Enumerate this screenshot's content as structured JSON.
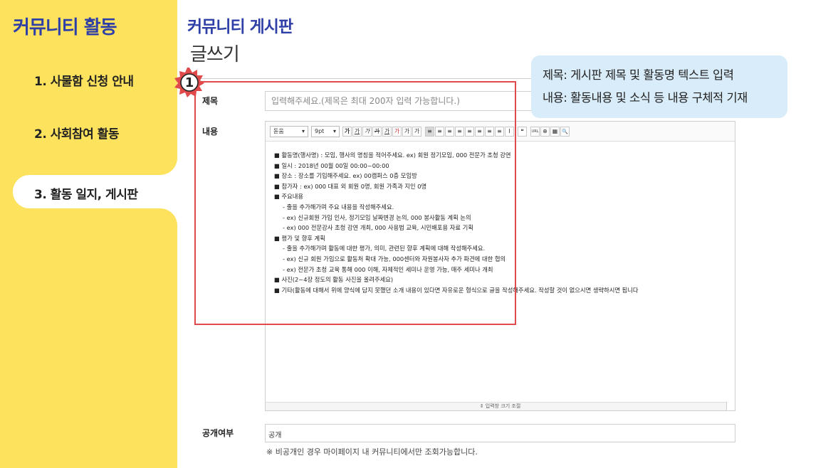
{
  "sidebar": {
    "title": "커뮤니티 활동",
    "items": [
      {
        "label": "1. 사물함 신청 안내"
      },
      {
        "label": "2. 사회참여 활동"
      },
      {
        "label": "3. 활동 일지, 게시판"
      }
    ],
    "active_index": 2
  },
  "header": {
    "title": "커뮤니티 게시판",
    "subtitle": "글쓰기"
  },
  "form": {
    "title_label": "제목",
    "title_placeholder": "입력해주세요.(제목은 최대 200자 입력 가능합니다.)",
    "content_label": "내용",
    "toolbar": {
      "font": "돋움",
      "size": "9pt",
      "buttons": [
        "가",
        "가",
        "가",
        "가",
        "가",
        "가",
        "가",
        "가",
        "≡",
        "≡",
        "≡",
        "≡",
        "≡",
        "≡",
        "≡",
        "≡",
        "I",
        "❝",
        "URL",
        "⊕",
        "▦",
        "🔍"
      ]
    },
    "content_lines": [
      {
        "text": "■ 활동명(행사명) : 모임, 행사의 명칭을 적어주세요. ex) 회원 정기모임, 000 전문가 초청 강연",
        "indent": false
      },
      {
        "text": "■ 일시 : 2018년 00월 00일 00:00~00:00",
        "indent": false
      },
      {
        "text": "■ 장소 : 장소를 기입해주세요. ex) 00캠퍼스 0층 모임방",
        "indent": false
      },
      {
        "text": "■ 참가자 : ex) 000 대표 외 회원 0명, 회원 가족과 지인 0명",
        "indent": false
      },
      {
        "text": "■ 주요내용",
        "indent": false
      },
      {
        "text": "- 줄을 추가해가며 주요 내용을 작성해주세요.",
        "indent": true
      },
      {
        "text": "- ex) 신규회원 가입 인사, 정기모임 날짜변경 논의, 000 봉사활동 계획 논의",
        "indent": true
      },
      {
        "text": "- ex) 000 전문강사 초청 강연 개최, 000 사용법 교육, 시민배포용 자료 기획",
        "indent": true
      },
      {
        "text": "■ 평가 및 향후 계획",
        "indent": false
      },
      {
        "text": "- 줄을 추가해가며 활동에 대한 평가, 의미, 관련된 향후 계획에 대해 작성해주세요.",
        "indent": true
      },
      {
        "text": "- ex) 신규 회원 가입으로 활동처 확대 가능, 000센터와 자원봉사자 추가 파견에 대한 협의",
        "indent": true
      },
      {
        "text": "- ex) 전문가 초청 교육 통해 000 이해, 자체적인 세미나 운영 가능, 매주 세미나 개최",
        "indent": true
      },
      {
        "text": "■ 사진(2~4장 정도의 활동 사진을 올려주세요)",
        "indent": false
      },
      {
        "text": "■ 기타(활동에 대해서 위에 양식에 담지 못했던 소개 내용이 있다면 자유로운 형식으로 글을 작성해주세요. 작성할 것이 없으시면 생략하시면 됩니다",
        "indent": false
      }
    ],
    "resize_label": "⇕ 입력창 크기 조절",
    "public_label": "공개여부",
    "public_value": "공개",
    "public_note": "※ 비공개인 경우 마이페이지 내 커뮤니티에서만 조회가능합니다."
  },
  "annotation": {
    "badge_number": "1",
    "tooltip_line1": "제목: 게시판 제목 및 활동명 텍스트 입력",
    "tooltip_line2": "내용: 활동내용 및 소식 등 내용 구체적 기재",
    "highlight_color": "#e04a4a",
    "badge_color": "#e04a4a",
    "tooltip_bg": "#d9ecf9"
  },
  "colors": {
    "sidebar_bg": "#fde25d",
    "accent": "#2f3fa8"
  }
}
